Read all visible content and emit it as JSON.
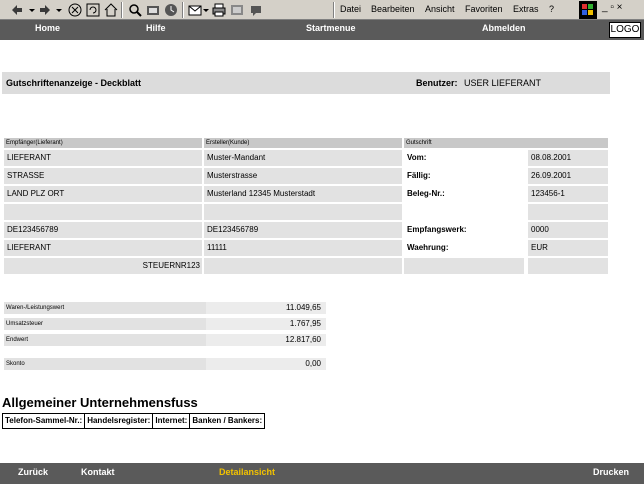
{
  "browser": {
    "toolbar_icons": [
      "back-icon",
      "forward-icon",
      "stop-icon",
      "refresh-icon",
      "home-icon",
      "search-icon",
      "favorites-icon",
      "history-icon",
      "mail-icon",
      "print-icon",
      "edit-icon",
      "discuss-icon"
    ],
    "menu": [
      {
        "label": "Datei"
      },
      {
        "label": "Bearbeiten"
      },
      {
        "label": "Ansicht"
      },
      {
        "label": "Favoriten"
      },
      {
        "label": "Extras"
      },
      {
        "label": "?"
      }
    ],
    "window_controls": "_ ▫ ×"
  },
  "nav": {
    "home": "Home",
    "help": "Hilfe",
    "startmenu": "Startmenue",
    "logout": "Abmelden",
    "logo": "LOGO"
  },
  "header": {
    "title": "Gutschriftenanzeige - Deckblatt",
    "user_label": "Benutzer:",
    "user_value": "USER LIEFERANT"
  },
  "columns": {
    "recipient_header": "Empfänger(Lieferant)",
    "issuer_header": "Ersteller(Kunde)",
    "credit_header": "Gutschrift"
  },
  "recipient": {
    "name": "LIEFERANT",
    "street": "STRASSE",
    "city": "LAND  PLZ   ORT",
    "vat": "DE123456789",
    "name2": "LIEFERANT",
    "tax_no": "STEUERNR123"
  },
  "issuer": {
    "name": "Muster-Mandant",
    "street": "Musterstrasse",
    "city": "Musterland  12345   Musterstadt",
    "vat": "DE123456789",
    "number": "11111"
  },
  "credit": {
    "from_label": "Vom:",
    "from_value": "08.08.2001",
    "due_label": "Fällig:",
    "due_value": "26.09.2001",
    "doc_label": "Beleg-Nr.:",
    "doc_value": "123456-1",
    "plant_label": "Empfangswerk:",
    "plant_value": "0000",
    "currency_label": "Waehrung:",
    "currency_value": "EUR"
  },
  "totals": [
    {
      "label": "Waren-/Leistungswert",
      "value": "11.049,65"
    },
    {
      "label": "Umsatzsteuer",
      "value": "1.767,95"
    },
    {
      "label": "Endwert",
      "value": "12.817,60"
    }
  ],
  "skonto": {
    "label": "Skonto",
    "value": "0,00"
  },
  "footer": {
    "heading": "Allgemeiner Unternehmensfuss",
    "cells": [
      "Telefon-Sammel-Nr.:",
      "Handelsregister:",
      "Internet:",
      "Banken / Bankers:"
    ]
  },
  "bottom": {
    "back": "Zurück",
    "contact": "Kontakt",
    "detail": "Detailansicht",
    "print": "Drucken"
  },
  "colors": {
    "nav_bg": "#5a5a5a",
    "active_link": "#f2c200"
  }
}
